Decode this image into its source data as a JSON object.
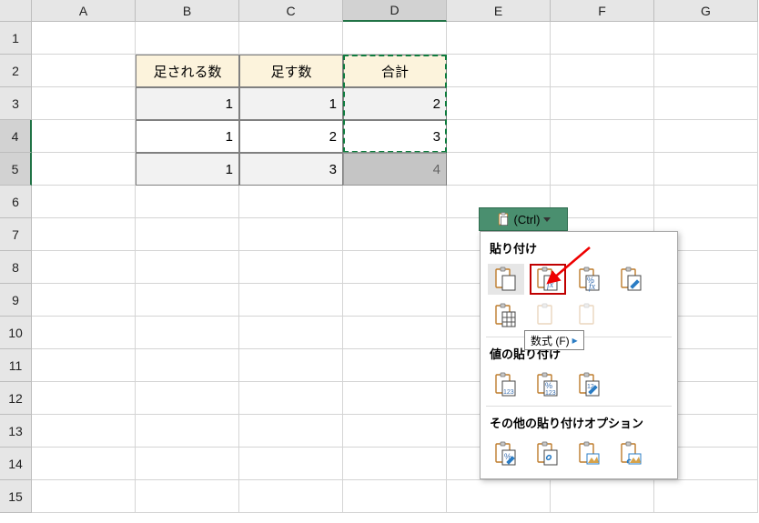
{
  "columns": [
    "A",
    "B",
    "C",
    "D",
    "E",
    "F",
    "G"
  ],
  "rows": [
    "1",
    "2",
    "3",
    "4",
    "5",
    "6",
    "7",
    "8",
    "9",
    "10",
    "11",
    "12",
    "13",
    "14",
    "15"
  ],
  "active_col": "D",
  "active_rows": [
    "4",
    "5"
  ],
  "table": {
    "headers": {
      "B": "足される数",
      "C": "足す数",
      "D": "合計"
    },
    "data": [
      {
        "B": "1",
        "C": "1",
        "D": "2"
      },
      {
        "B": "1",
        "C": "2",
        "D": "3"
      },
      {
        "B": "1",
        "C": "3",
        "D": "4"
      }
    ]
  },
  "paste_button": {
    "label": "(Ctrl)"
  },
  "menu": {
    "section1": "貼り付け",
    "section2": "値の貼り付け",
    "section3": "その他の貼り付けオプション"
  },
  "tooltip": "数式 (F)",
  "icons": {
    "clipboard": "clipboard-icon",
    "paste_all": "paste-all-icon",
    "paste_formulas": "paste-formulas-icon",
    "paste_formulas_num": "paste-formulas-number-icon",
    "paste_formatting": "paste-source-formatting-icon",
    "paste_noborder": "paste-no-border-icon",
    "values": "paste-values-icon",
    "values_num": "paste-values-number-icon",
    "values_fmt": "paste-values-formatting-icon",
    "other_fmt": "paste-formatting-only-icon",
    "other_link": "paste-link-icon",
    "other_pic": "paste-picture-icon",
    "other_linkpic": "paste-linked-picture-icon"
  },
  "chart_data": {
    "type": "table",
    "title": "",
    "columns": [
      "足される数",
      "足す数",
      "合計"
    ],
    "rows": [
      [
        1,
        1,
        2
      ],
      [
        1,
        2,
        3
      ],
      [
        1,
        3,
        4
      ]
    ]
  }
}
